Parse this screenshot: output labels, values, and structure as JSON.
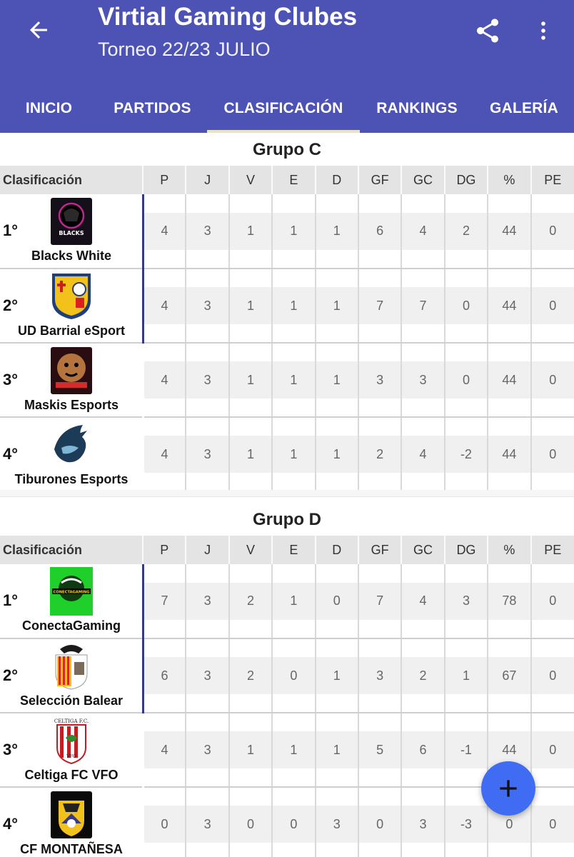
{
  "app": {
    "title": "Virtial Gaming Clubes",
    "subtitle": "Torneo 22/23 JULIO",
    "header_color": "#4d53b5",
    "icons": [
      "arrow-back-icon",
      "share-icon",
      "more-vert-icon",
      "add-icon"
    ]
  },
  "tabs": [
    {
      "label": "INICIO"
    },
    {
      "label": "PARTIDOS"
    },
    {
      "label": "CLASIFICACIÓN",
      "active": true
    },
    {
      "label": "RANKINGS"
    },
    {
      "label": "GALERÍA"
    }
  ],
  "headers": {
    "name": "Clasificación",
    "cols": [
      "P",
      "J",
      "V",
      "E",
      "D",
      "GF",
      "GC",
      "DG",
      "%",
      "PE"
    ]
  },
  "groups": [
    {
      "title": "Grupo C",
      "rows": [
        {
          "pos": "1°",
          "team": "Blacks White",
          "qualified": true,
          "logo_text": "BLACKS",
          "values": [
            "4",
            "3",
            "1",
            "1",
            "1",
            "6",
            "4",
            "2",
            "44",
            "0"
          ]
        },
        {
          "pos": "2°",
          "team": "UD Barrial eSport",
          "qualified": true,
          "logo_text": "",
          "values": [
            "4",
            "3",
            "1",
            "1",
            "1",
            "7",
            "7",
            "0",
            "44",
            "0"
          ]
        },
        {
          "pos": "3°",
          "team": "Maskis Esports",
          "qualified": false,
          "logo_text": "",
          "values": [
            "4",
            "3",
            "1",
            "1",
            "1",
            "3",
            "3",
            "0",
            "44",
            "0"
          ]
        },
        {
          "pos": "4°",
          "team": "Tiburones Esports",
          "qualified": false,
          "logo_text": "",
          "values": [
            "4",
            "3",
            "1",
            "1",
            "1",
            "2",
            "4",
            "-2",
            "44",
            "0"
          ]
        }
      ]
    },
    {
      "title": "Grupo D",
      "rows": [
        {
          "pos": "1°",
          "team": "ConectaGaming",
          "qualified": true,
          "logo_text": "CONECTAGAMING",
          "values": [
            "7",
            "3",
            "2",
            "1",
            "0",
            "7",
            "4",
            "3",
            "78",
            "0"
          ]
        },
        {
          "pos": "2°",
          "team": "Selección Balear",
          "qualified": true,
          "logo_text": "",
          "values": [
            "6",
            "3",
            "2",
            "0",
            "1",
            "3",
            "2",
            "1",
            "67",
            "0"
          ]
        },
        {
          "pos": "3°",
          "team": "Celtiga FC VFO",
          "qualified": false,
          "logo_text": "CELTIGA F.C.",
          "values": [
            "4",
            "3",
            "1",
            "1",
            "1",
            "5",
            "6",
            "-1",
            "44",
            "0"
          ]
        },
        {
          "pos": "4°",
          "team": "CF MONTAÑESA",
          "qualified": false,
          "logo_text": "",
          "values": [
            "0",
            "3",
            "0",
            "0",
            "3",
            "0",
            "3",
            "-3",
            "0",
            "0"
          ]
        }
      ]
    }
  ]
}
